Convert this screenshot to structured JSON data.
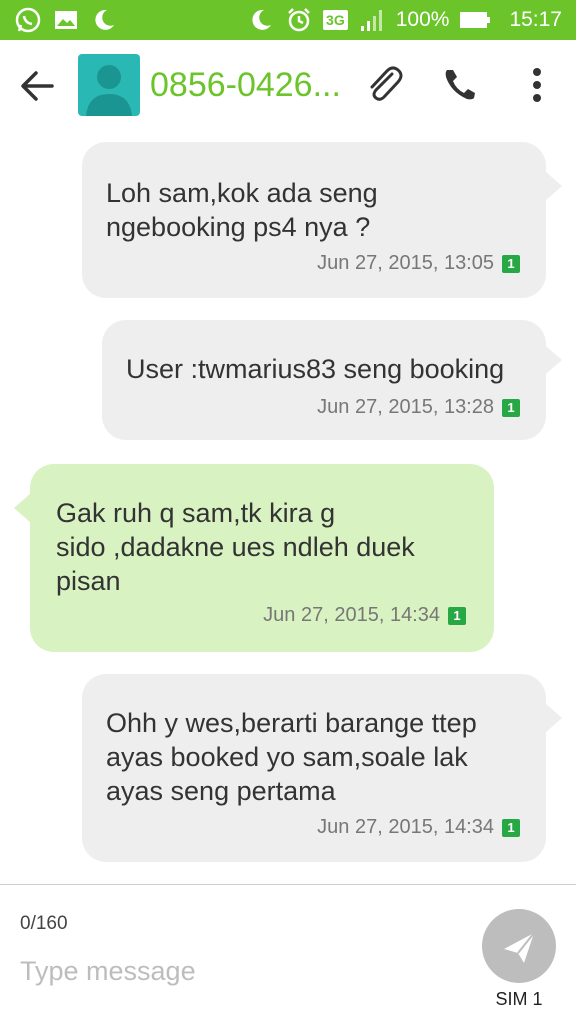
{
  "status_bar": {
    "battery": "100%",
    "time": "15:17",
    "network": "3G",
    "color": "#6bc52a"
  },
  "header": {
    "contact": "0856-0426...",
    "accent": "#6bc52a"
  },
  "messages": [
    {
      "direction": "outgoing",
      "lines": [
        "Loh sam,kok ada seng",
        "ngebooking ps4 nya ?"
      ],
      "timestamp": "Jun 27, 2015, 13:05",
      "sim": "1"
    },
    {
      "direction": "outgoing",
      "lines": [
        "User :twmarius83 seng booking"
      ],
      "timestamp": "Jun 27, 2015, 13:28",
      "sim": "1"
    },
    {
      "direction": "incoming",
      "lines": [
        "Gak ruh q sam,tk kira g",
        "sido ,dadakne ues ndleh duek",
        "pisan"
      ],
      "timestamp": "Jun 27, 2015, 14:34",
      "sim": "1"
    },
    {
      "direction": "outgoing",
      "lines": [
        "Ohh y wes,berarti barange ttep",
        "ayas booked yo sam,soale lak",
        "ayas seng pertama"
      ],
      "timestamp": "Jun 27, 2015, 14:34",
      "sim": "1"
    }
  ],
  "composer": {
    "counter": "0/160",
    "placeholder": "Type message",
    "sim_label": "SIM 1"
  }
}
